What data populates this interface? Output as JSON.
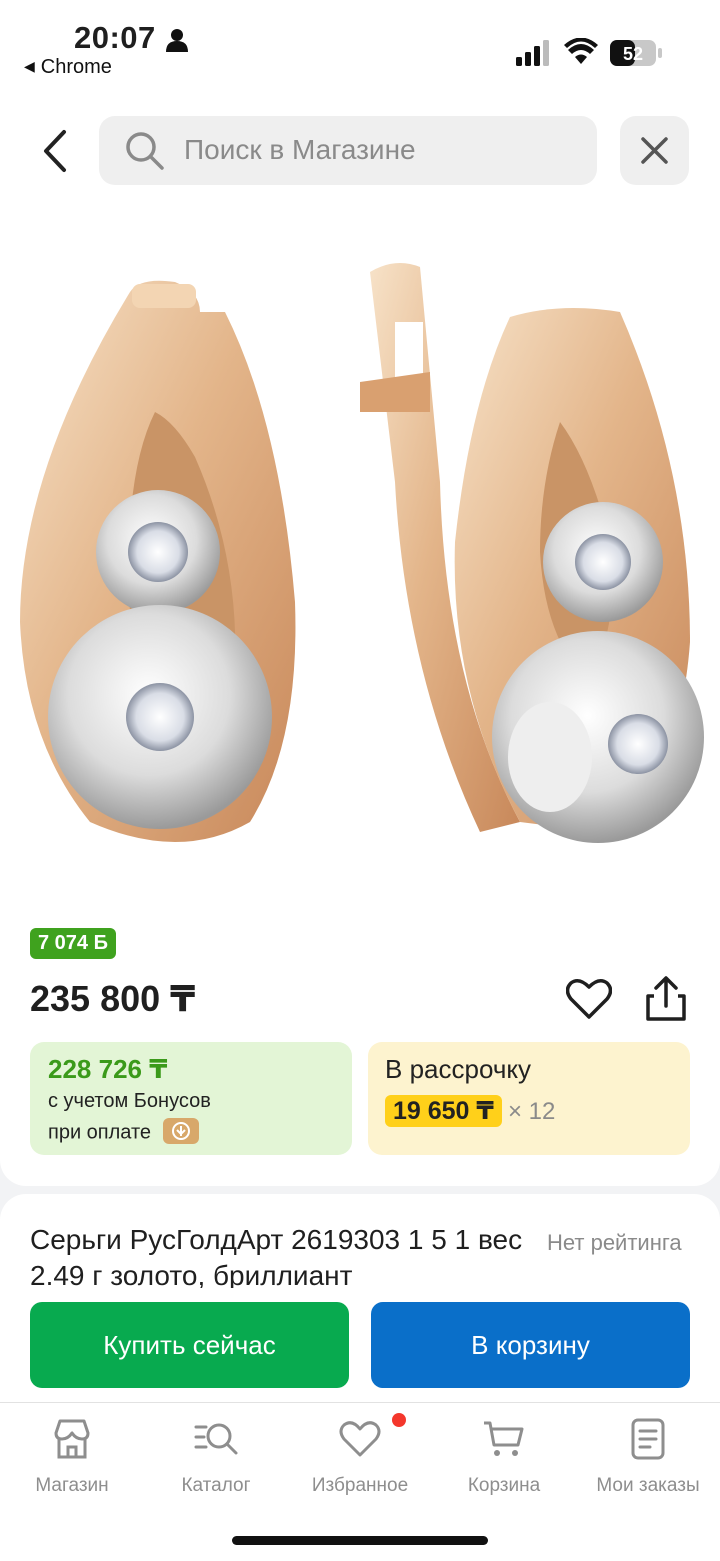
{
  "status_bar": {
    "time": "20:07",
    "back_app": "Chrome",
    "battery": "52"
  },
  "search": {
    "placeholder": "Поиск в Магазине"
  },
  "product": {
    "bonus_badge": "7 074 Б",
    "price": "235 800 ₸",
    "promo_bonus": {
      "price": "228 726 ₸",
      "line1": "с учетом Бонусов",
      "line2": "при оплате"
    },
    "installment": {
      "title": "В рассрочку",
      "amount": "19 650 ₸",
      "multiplier": "× 12"
    },
    "title": "Серьги РусГолдАрт 2619303 1 5 1 вес 2.49 г золото, бриллиант",
    "rating": "Нет рейтинга"
  },
  "actions": {
    "buy_now": "Купить сейчас",
    "add_to_cart": "В корзину"
  },
  "tabbar": {
    "items": [
      {
        "label": "Магазин",
        "icon": "store-icon"
      },
      {
        "label": "Каталог",
        "icon": "catalog-icon"
      },
      {
        "label": "Избранное",
        "icon": "heart-icon"
      },
      {
        "label": "Корзина",
        "icon": "cart-icon"
      },
      {
        "label": "Мои заказы",
        "icon": "orders-icon"
      }
    ]
  },
  "colors": {
    "buy": "#08aa4f",
    "cart": "#0a6fc9",
    "bonus": "#3fa21e",
    "installment_highlight": "#ffd01a"
  }
}
